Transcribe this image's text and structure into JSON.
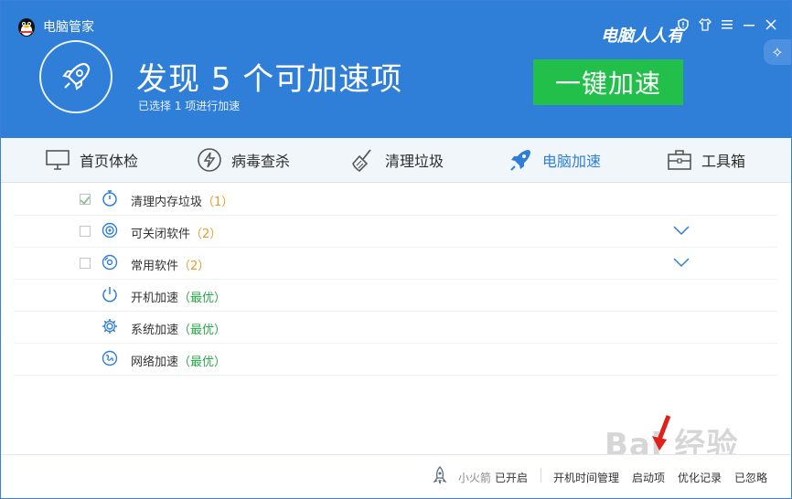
{
  "window": {
    "title": "电脑管家",
    "watermark": "电脑人人有"
  },
  "header": {
    "headline": "发现 5 个可加速项",
    "subtitle": "已选择 1 项进行加速",
    "primary_button": "一键加速"
  },
  "nav": {
    "items": [
      {
        "label": "首页体检",
        "icon": "monitor-icon"
      },
      {
        "label": "病毒查杀",
        "icon": "lightning-shield-icon"
      },
      {
        "label": "清理垃圾",
        "icon": "broom-icon"
      },
      {
        "label": "电脑加速",
        "icon": "rocket-icon",
        "active": true
      },
      {
        "label": "工具箱",
        "icon": "toolbox-icon"
      }
    ]
  },
  "rows": [
    {
      "label": "清理内存垃圾",
      "count": "（1）",
      "checked": true,
      "icon": "stopwatch-icon"
    },
    {
      "label": "可关闭软件",
      "count": "（2）",
      "checked": false,
      "icon": "target-icon"
    },
    {
      "label": "常用软件",
      "count": "（2）",
      "checked": false,
      "icon": "disc-icon"
    },
    {
      "label": "开机加速",
      "count": "（最优）",
      "icon": "power-icon"
    },
    {
      "label": "系统加速",
      "count": "（最优）",
      "icon": "gear-icon"
    },
    {
      "label": "网络加速",
      "count": "（最优）",
      "icon": "network-icon"
    }
  ],
  "footer": {
    "rocket_label": "小火箭",
    "rocket_status": "已开启",
    "links": [
      "开机时间管理",
      "启动项",
      "优化记录",
      "已忽略"
    ]
  },
  "overlay": {
    "baidu_watermark": "Bai 经验"
  },
  "colors": {
    "header_blue": "#2f7ed8",
    "primary_green": "#22c04a",
    "active_blue": "#2f7ed8",
    "count_orange": "#e99a2a",
    "count_green": "#2aa64a"
  }
}
